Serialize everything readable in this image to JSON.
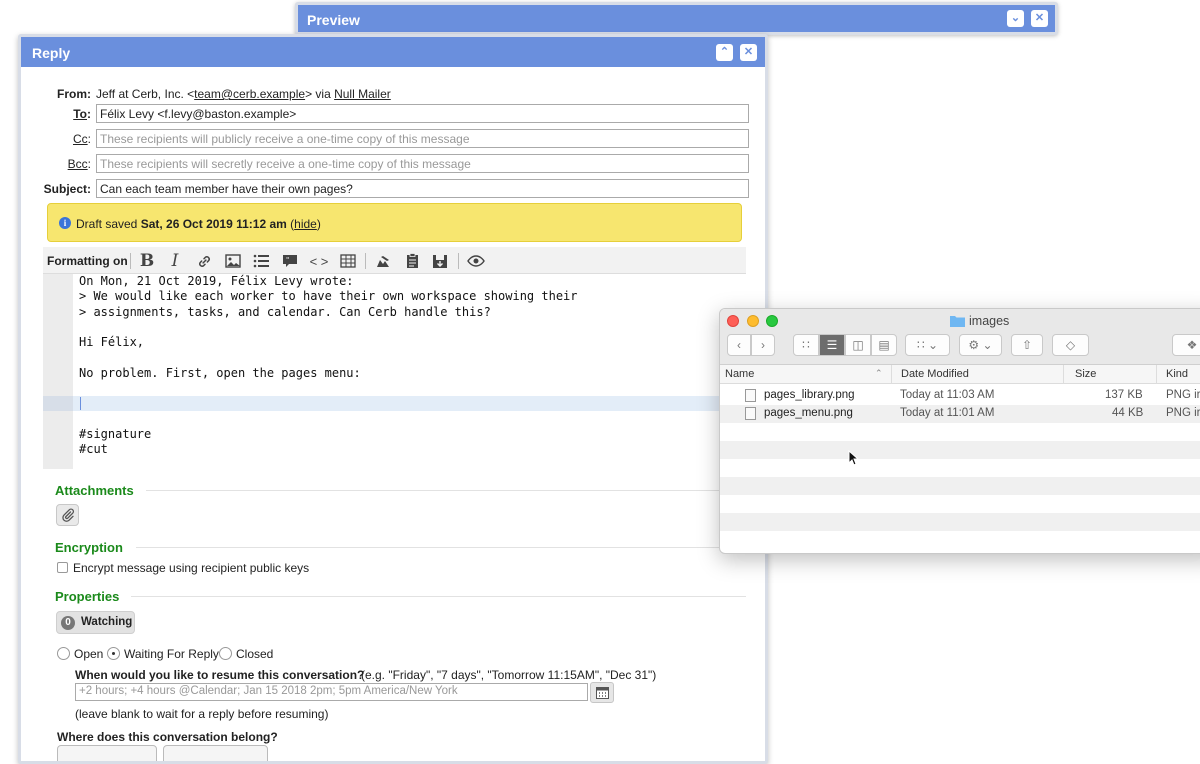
{
  "preview": {
    "title": "Preview"
  },
  "reply": {
    "title": "Reply",
    "from_label": "From:",
    "from_name": "Jeff at Cerb, Inc. <",
    "from_email": "team@cerb.example",
    "from_via": "> via ",
    "from_mailer": "Null Mailer",
    "to_label": "To",
    "to_value": "Félix Levy <f.levy@baston.example>",
    "cc_label": "Cc",
    "cc_placeholder": "These recipients will publicly receive a one-time copy of this message",
    "bcc_label": "Bcc",
    "bcc_placeholder": "These recipients will secretly receive a one-time copy of this message",
    "subject_label": "Subject:",
    "subject_value": "Can each team member have their own pages?",
    "draft_prefix": "Draft saved ",
    "draft_date": "Sat, 26 Oct 2019 11:12 am",
    "draft_open": " (",
    "draft_hide": "hide",
    "draft_close": ")",
    "formatting_label": "Formatting on",
    "body": "On Mon, 21 Oct 2019, Félix Levy wrote:\n> We would like each worker to have their own workspace showing their\n> assignments, tasks, and calendar. Can Cerb handle this?\n\nHi Félix,\n\nNo problem. First, open the pages menu:\n\n\n\n#signature\n#cut",
    "attachments_title": "Attachments",
    "encryption_title": "Encryption",
    "encrypt_label": "Encrypt message using recipient public keys",
    "properties_title": "Properties",
    "watchers_count": "0",
    "watching_label": "Watching",
    "status_open": "Open",
    "status_waiting": "Waiting For Reply",
    "status_closed": "Closed",
    "resume_question": "When would you like to resume this conversation?",
    "resume_examples": "(e.g. \"Friday\", \"7 days\", \"Tomorrow 11:15AM\", \"Dec 31\")",
    "resume_placeholder": "+2 hours; +4 hours @Calendar; Jan 15 2018 2pm; 5pm America/New York",
    "resume_hint": "(leave blank to wait for a reply before resuming)",
    "belong_question": "Where does this conversation belong?"
  },
  "finder": {
    "title": "images",
    "col_name": "Name",
    "col_date": "Date Modified",
    "col_size": "Size",
    "col_kind": "Kind",
    "files": [
      {
        "name": "pages_library.png",
        "date": "Today at 11:03 AM",
        "size": "137 KB",
        "kind": "PNG ir"
      },
      {
        "name": "pages_menu.png",
        "date": "Today at 11:01 AM",
        "size": "44 KB",
        "kind": "PNG ir"
      }
    ]
  },
  "colors": {
    "titlebar": "#6a8fdd",
    "section": "#1b8a1b",
    "draft_bg": "#f7e66f"
  }
}
